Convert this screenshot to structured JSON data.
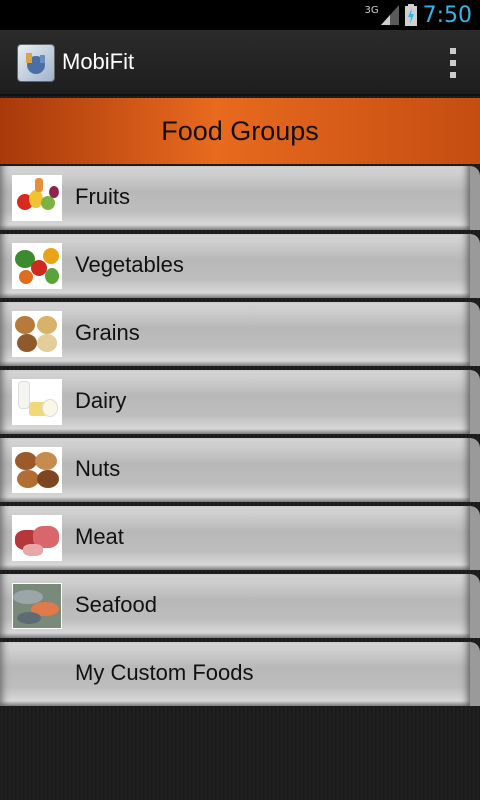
{
  "status_bar": {
    "network": "3G",
    "time": "7:50",
    "time_color": "#33b5e5"
  },
  "action_bar": {
    "app_title": "MobiFit",
    "app_icon": "app-logo-icon",
    "overflow_icon": "overflow-menu-icon"
  },
  "header": {
    "title": "Food Groups",
    "accent_color": "#e86a1f"
  },
  "food_groups": [
    {
      "label": "Fruits",
      "icon": "fruits-thumbnail"
    },
    {
      "label": "Vegetables",
      "icon": "vegetables-thumbnail"
    },
    {
      "label": "Grains",
      "icon": "grains-thumbnail"
    },
    {
      "label": "Dairy",
      "icon": "dairy-thumbnail"
    },
    {
      "label": "Nuts",
      "icon": "nuts-thumbnail"
    },
    {
      "label": "Meat",
      "icon": "meat-thumbnail"
    },
    {
      "label": "Seafood",
      "icon": "seafood-thumbnail"
    },
    {
      "label": "My Custom Foods",
      "icon": ""
    }
  ]
}
